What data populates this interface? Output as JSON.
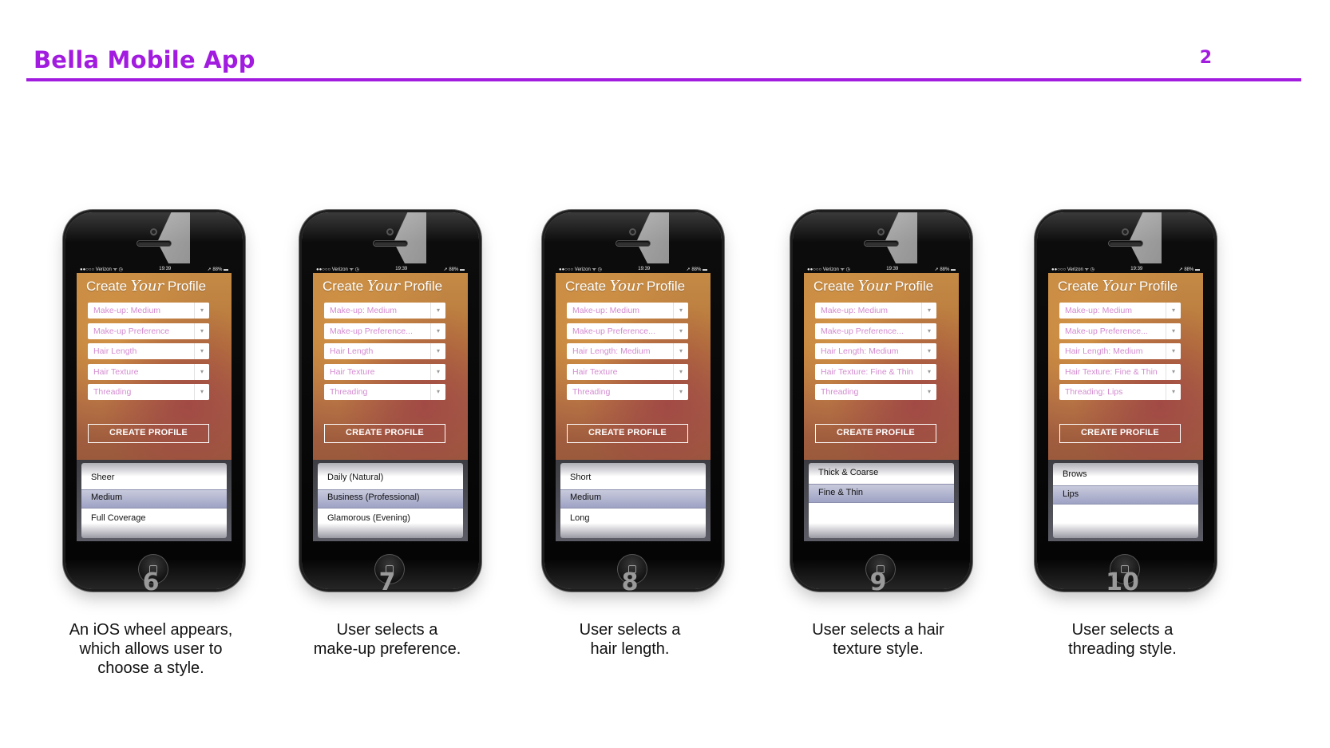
{
  "slide": {
    "title": "Bella Mobile App",
    "page_number": "2"
  },
  "colors": {
    "accent": "#a21ce0",
    "step_number": "#9a9a9a"
  },
  "phone_common": {
    "carrier": "●●○○○ Verizon ᯤ ◷",
    "time": "19:39",
    "battery": "➚ 88% ▬",
    "app_title_pre": "Create",
    "app_title_script": "Your",
    "app_title_post": "Profile",
    "create_button": "CREATE PROFILE",
    "chevron": "▾"
  },
  "steps": [
    {
      "number": "6",
      "caption": [
        "An iOS wheel appears,",
        "which allows user to",
        "choose a style."
      ],
      "fields": [
        "Make-up: Medium",
        "Make-up Preference",
        "Hair Length",
        "Hair Texture",
        "Threading"
      ],
      "wheel": [
        "Sheer",
        "Medium",
        "Full Coverage"
      ]
    },
    {
      "number": "7",
      "caption": [
        "User selects a",
        "make-up preference."
      ],
      "fields": [
        "Make-up: Medium",
        "Make-up Preference...",
        "Hair Length",
        "Hair Texture",
        "Threading"
      ],
      "wheel": [
        "Daily (Natural)",
        "Business (Professional)",
        "Glamorous (Evening)"
      ]
    },
    {
      "number": "8",
      "caption": [
        "User selects a",
        "hair length."
      ],
      "fields": [
        "Make-up: Medium",
        "Make-up Preference...",
        "Hair Length: Medium",
        "Hair Texture",
        "Threading"
      ],
      "wheel": [
        "Short",
        "Medium",
        "Long"
      ]
    },
    {
      "number": "9",
      "caption": [
        "User selects a hair",
        "texture style."
      ],
      "fields": [
        "Make-up: Medium",
        "Make-up Preference...",
        "Hair Length: Medium",
        "Hair Texture: Fine & Thin",
        "Threading"
      ],
      "wheel": [
        "Thick & Coarse",
        "Fine & Thin",
        ""
      ]
    },
    {
      "number": "10",
      "caption": [
        "User selects a",
        "threading style."
      ],
      "fields": [
        "Make-up: Medium",
        "Make-up Preference...",
        "Hair Length: Medium",
        "Hair Texture: Fine & Thin",
        "Threading: Lips"
      ],
      "wheel": [
        "Brows",
        "Lips",
        ""
      ]
    }
  ]
}
